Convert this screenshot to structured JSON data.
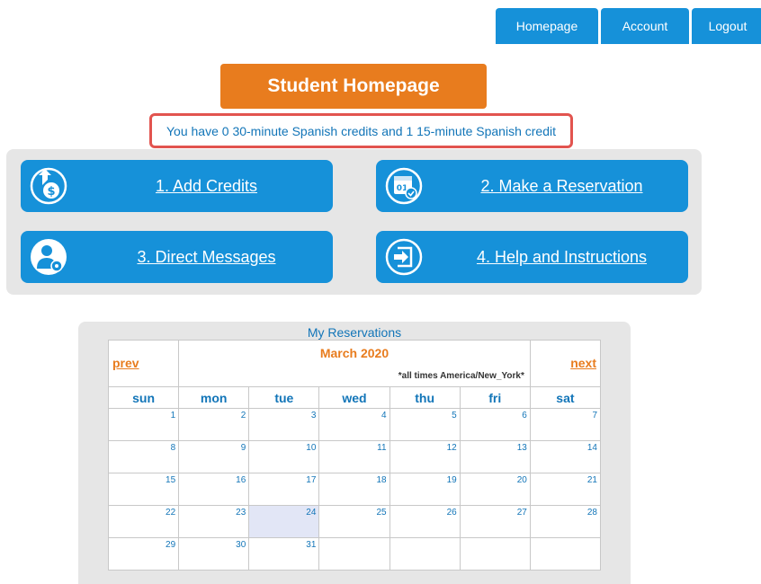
{
  "nav": {
    "homepage": "Homepage",
    "account": "Account",
    "logout": "Logout"
  },
  "page_title": "Student Homepage",
  "credits_notice": "You have 0 30-minute Spanish credits and 1 15-minute Spanish credit",
  "actions": [
    {
      "label": "1. Add Credits",
      "icon": "dollar-upload-icon"
    },
    {
      "label": "2. Make a Reservation",
      "icon": "calendar-check-icon"
    },
    {
      "label": "3. Direct Messages",
      "icon": "user-gear-icon"
    },
    {
      "label": "4. Help and Instructions",
      "icon": "exit-arrow-icon"
    }
  ],
  "calendar": {
    "heading": "My Reservations",
    "prev": "prev",
    "next": "next",
    "month": "March 2020",
    "timezone_note": "*all times America/New_York*",
    "days_of_week": [
      "sun",
      "mon",
      "tue",
      "wed",
      "thu",
      "fri",
      "sat"
    ],
    "weeks": [
      [
        "1",
        "2",
        "3",
        "4",
        "5",
        "6",
        "7"
      ],
      [
        "8",
        "9",
        "10",
        "11",
        "12",
        "13",
        "14"
      ],
      [
        "15",
        "16",
        "17",
        "18",
        "19",
        "20",
        "21"
      ],
      [
        "22",
        "23",
        "24",
        "25",
        "26",
        "27",
        "28"
      ],
      [
        "29",
        "30",
        "31",
        "",
        "",
        "",
        ""
      ]
    ],
    "highlighted_day": "24"
  },
  "colors": {
    "primary_blue": "#1691d9",
    "accent_orange": "#e87c1e",
    "notice_border": "#e2544f",
    "highlight_day": "#e2e6f6"
  }
}
